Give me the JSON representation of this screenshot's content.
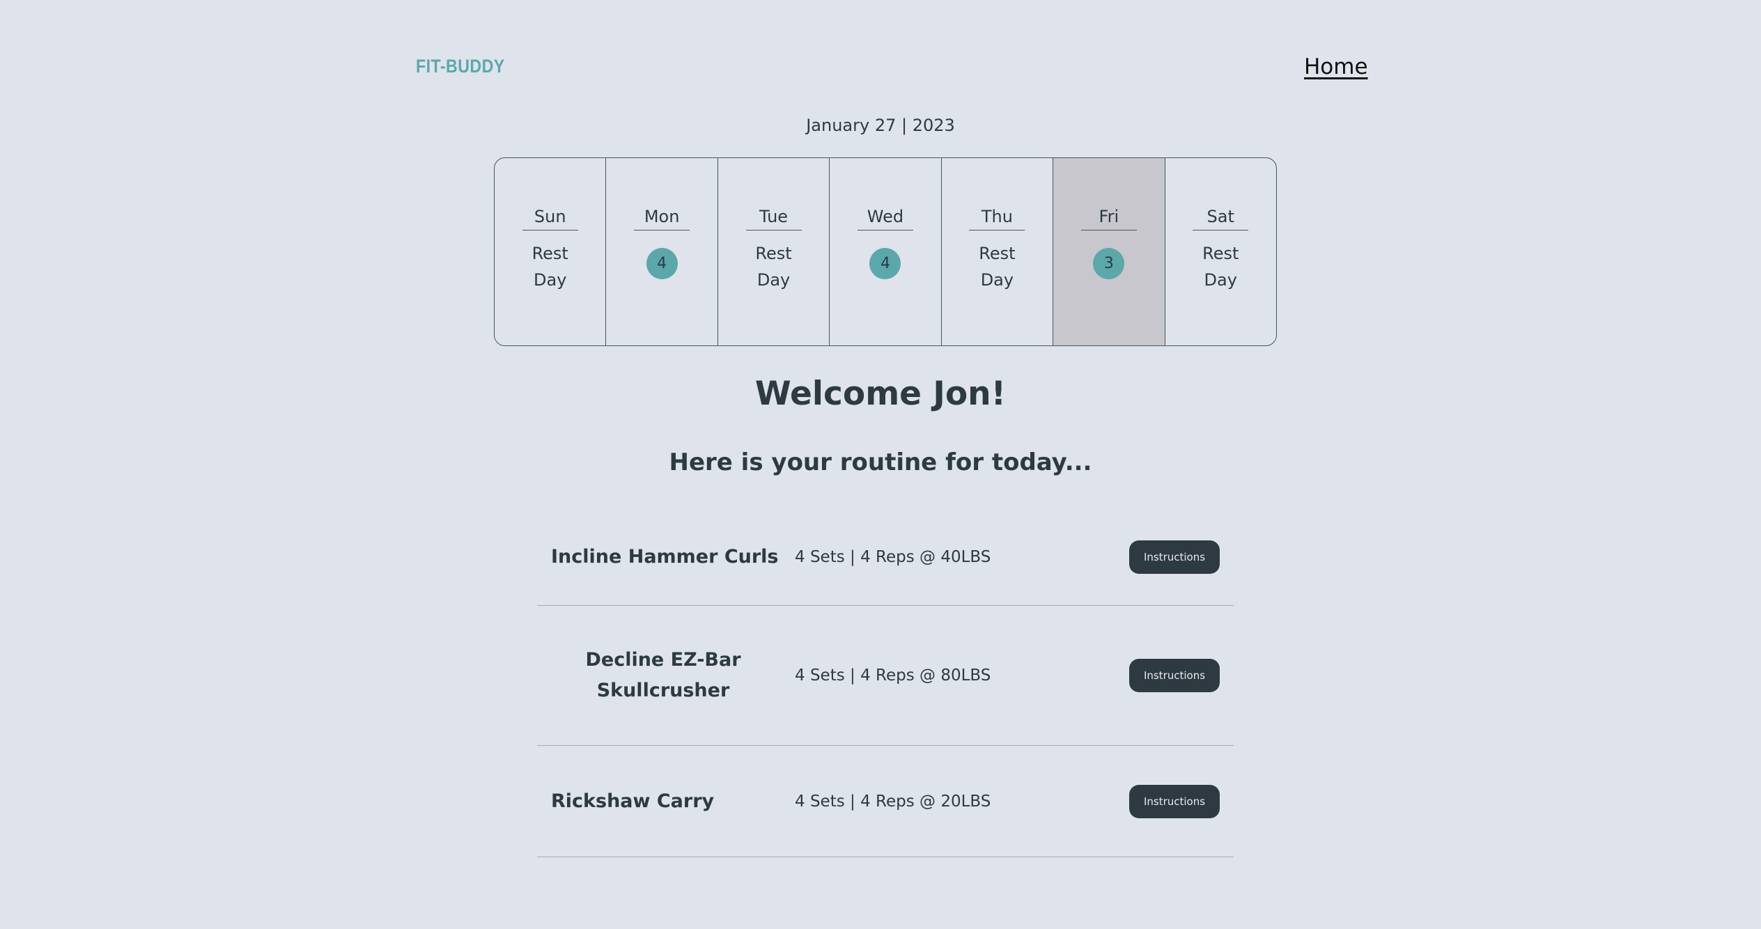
{
  "header": {
    "logo": "FIT-BUDDY",
    "nav_home": "Home"
  },
  "date": "January 27 | 2023",
  "week": [
    {
      "day": "Sun",
      "rest_1": "Rest",
      "rest_2": "Day"
    },
    {
      "day": "Mon",
      "count": "4"
    },
    {
      "day": "Tue",
      "rest_1": "Rest",
      "rest_2": "Day"
    },
    {
      "day": "Wed",
      "count": "4"
    },
    {
      "day": "Thu",
      "rest_1": "Rest",
      "rest_2": "Day"
    },
    {
      "day": "Fri",
      "count": "3",
      "active": true
    },
    {
      "day": "Sat",
      "rest_1": "Rest",
      "rest_2": "Day"
    }
  ],
  "welcome": "Welcome Jon!",
  "subtitle": "Here is your routine for today...",
  "routine": [
    {
      "name": "Incline Hammer Curls",
      "detail": "4 Sets | 4 Reps @ 40LBS",
      "button": "Instructions"
    },
    {
      "name_1": "Decline EZ-Bar",
      "name_2": "Skullcrusher",
      "detail": "4 Sets | 4 Reps @ 80LBS",
      "button": "Instructions"
    },
    {
      "name": "Rickshaw Carry",
      "detail": "4 Sets | 4 Reps @ 20LBS",
      "button": "Instructions"
    }
  ],
  "colors": {
    "background": "#dfe3ec",
    "accent": "#5ba8ab",
    "text": "#2d3a41",
    "button": "#2e3a42",
    "active_day": "#c8c7cd"
  }
}
